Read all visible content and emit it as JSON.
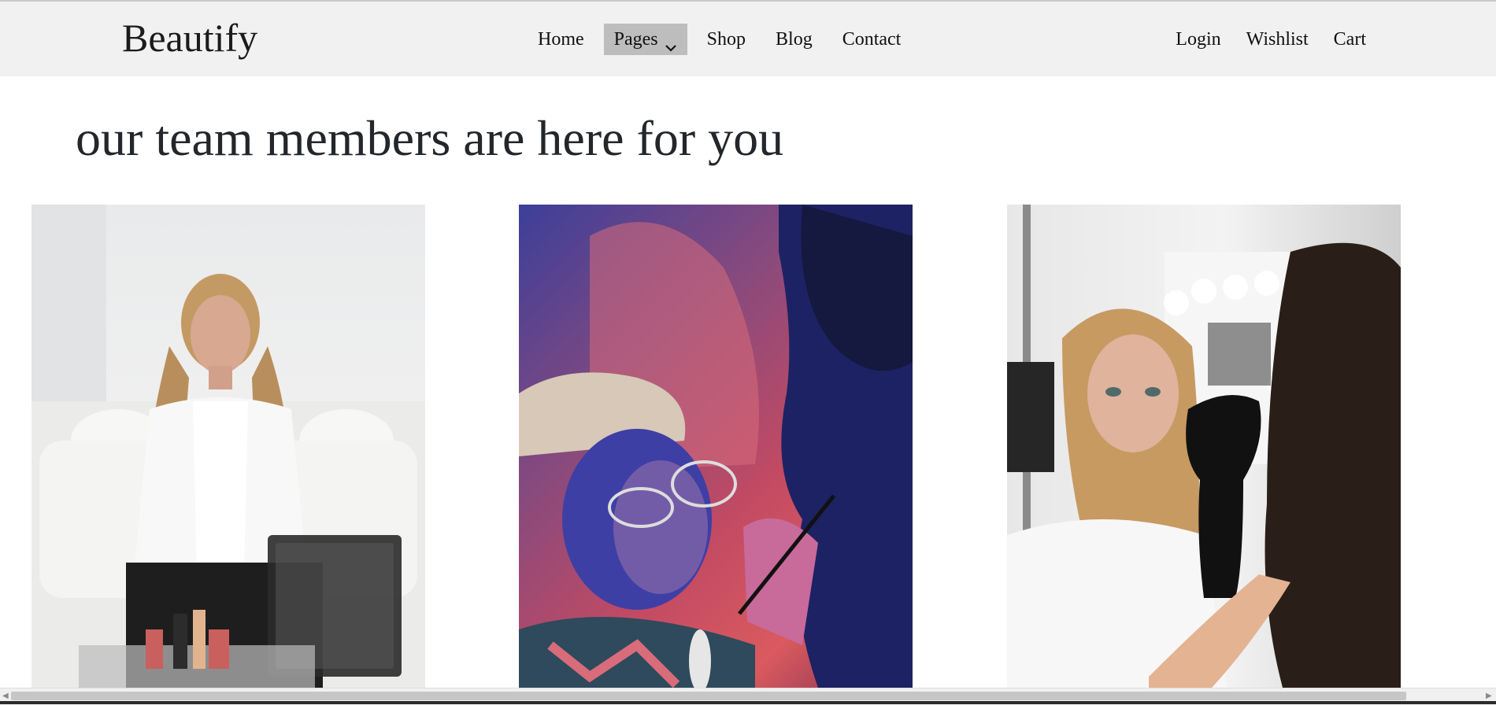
{
  "brand": "Beautify",
  "nav": {
    "items": [
      {
        "label": "Home",
        "active": false
      },
      {
        "label": "Pages",
        "active": true,
        "dropdown": true
      },
      {
        "label": "Shop",
        "active": false
      },
      {
        "label": "Blog",
        "active": false
      },
      {
        "label": "Contact",
        "active": false
      }
    ],
    "right": [
      {
        "label": "Login"
      },
      {
        "label": "Wishlist"
      },
      {
        "label": "Cart"
      }
    ]
  },
  "main": {
    "heading": "our team members are here for you",
    "team_photos": [
      {
        "subject": "woman in white blazer seated beside makeup bag"
      },
      {
        "subject": "person with glasses having makeup applied under red and blue light"
      },
      {
        "subject": "woman having brows shaped by artist wearing black glove"
      }
    ]
  },
  "colors": {
    "navbar_bg": "#f1f1f1",
    "active_nav_bg": "#bdbdbd",
    "text": "#212529"
  }
}
